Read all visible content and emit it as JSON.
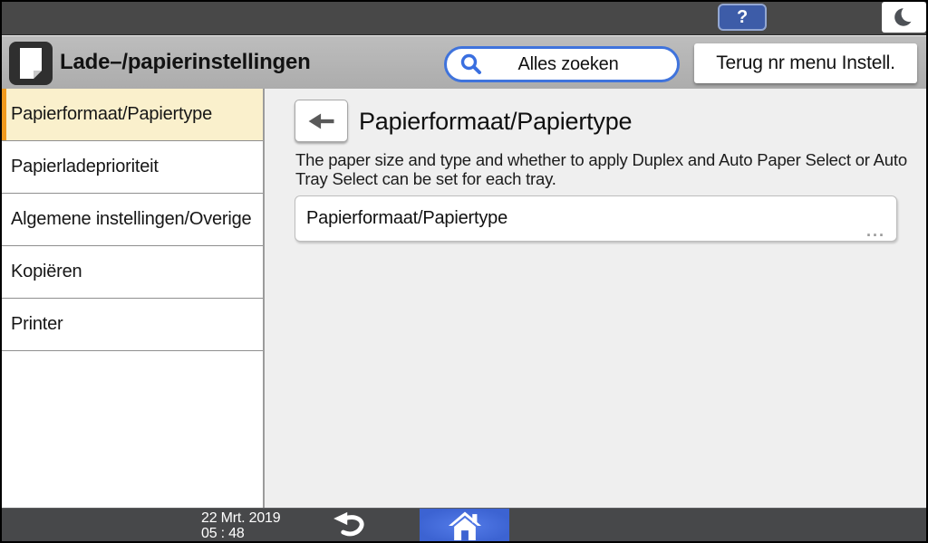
{
  "top_bar": {
    "help_label": "?",
    "help_icon": "help-icon",
    "sleep_icon": "moon-icon"
  },
  "header": {
    "app_icon": "document-icon",
    "title": "Lade–/papierinstellingen",
    "search": {
      "icon": "search-icon",
      "label": "Alles zoeken"
    },
    "back_to_settings_label": "Terug nr menu Instell."
  },
  "sidebar": {
    "items": [
      {
        "label": "Papierformaat/Papiertype",
        "selected": true
      },
      {
        "label": "Papierladeprioriteit",
        "selected": false
      },
      {
        "label": "Algemene instellingen/Overige",
        "selected": false
      },
      {
        "label": "Kopiëren",
        "selected": false
      },
      {
        "label": "Printer",
        "selected": false
      }
    ]
  },
  "main": {
    "back_icon": "arrow-left-icon",
    "title": "Papierformaat/Papiertype",
    "description": "The paper size and type and whether to apply Duplex and Auto Paper Select or Auto Tray Select can be set for each tray.",
    "setting_button": {
      "label": "Papierformaat/Papiertype",
      "more_indicator": "..."
    }
  },
  "bottom_bar": {
    "date": "22 Mrt. 2019",
    "time": "05 : 48",
    "undo_icon": "undo-arrow-icon",
    "home_icon": "home-icon"
  },
  "colors": {
    "accent_orange": "#F09A1E",
    "accent_blue": "#3F73DC",
    "selected_item_bg": "#FAF0CC",
    "help_button_blue": "#3D5CA8",
    "home_button_blue": "#3C63D2",
    "top_bar_gray": "#484848",
    "bottom_bar_gray": "#47484A"
  }
}
